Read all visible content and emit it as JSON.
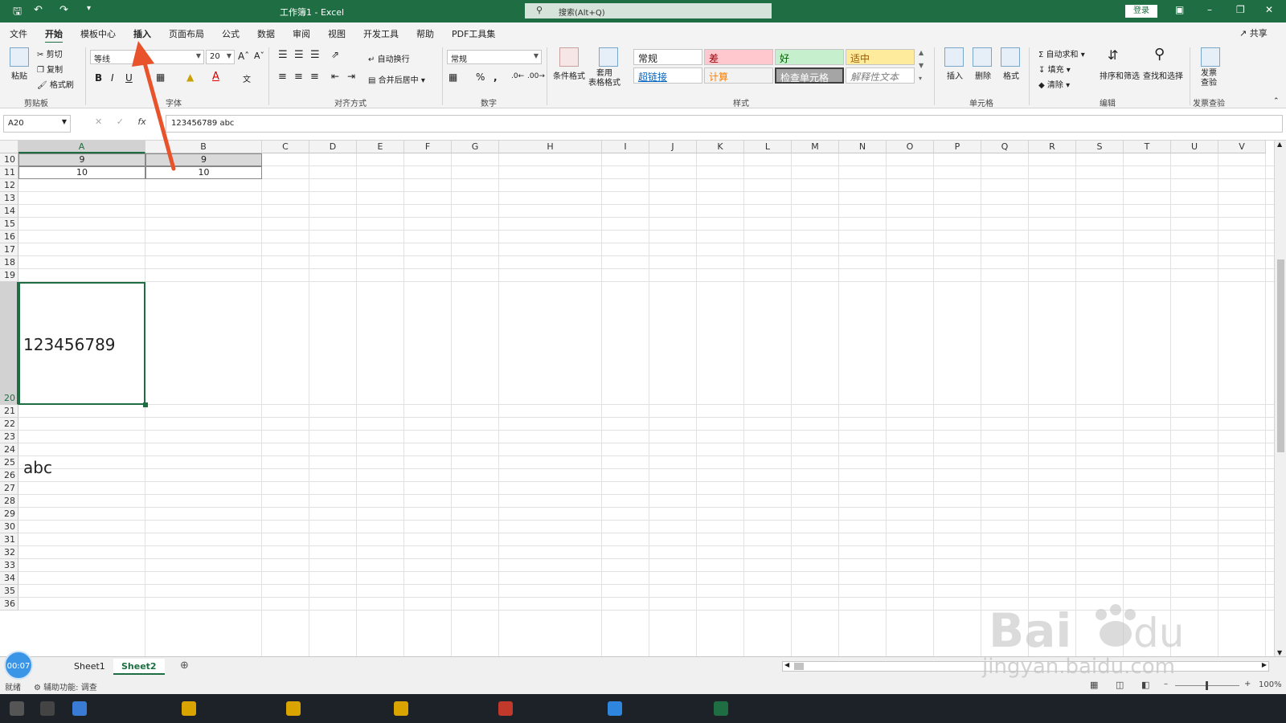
{
  "titlebar": {
    "title": "工作簿1  -  Excel",
    "search_placeholder": "搜索(Alt+Q)",
    "login": "登录"
  },
  "menu": {
    "tabs": [
      "文件",
      "开始",
      "模板中心",
      "插入",
      "页面布局",
      "公式",
      "数据",
      "审阅",
      "视图",
      "开发工具",
      "帮助",
      "PDF工具集"
    ],
    "active": "开始",
    "share": "共享"
  },
  "ribbon": {
    "clipboard": {
      "paste": "粘贴",
      "cut": "剪切",
      "copy": "复制",
      "format_painter": "格式刷",
      "label": "剪贴板"
    },
    "font": {
      "name": "等线",
      "size": "20",
      "label": "字体"
    },
    "alignment": {
      "wrap": "自动换行",
      "merge": "合并后居中",
      "label": "对齐方式"
    },
    "number": {
      "format": "常规",
      "label": "数字"
    },
    "styles": {
      "cond_format": "条件格式",
      "table_format": "套用\n表格格式",
      "items": [
        {
          "label": "常规",
          "bg": "#ffffff",
          "color": "#222222"
        },
        {
          "label": "差",
          "bg": "#ffc7ce",
          "color": "#9c0006"
        },
        {
          "label": "好",
          "bg": "#c6efce",
          "color": "#006100"
        },
        {
          "label": "适中",
          "bg": "#ffeb9c",
          "color": "#9c5700"
        },
        {
          "label": "超链接",
          "bg": "#ffffff",
          "color": "#0563c1"
        },
        {
          "label": "计算",
          "bg": "#f2f2f2",
          "color": "#fa7d00"
        },
        {
          "label": "检查单元格",
          "bg": "#a5a5a5",
          "color": "#ffffff"
        },
        {
          "label": "解释性文本",
          "bg": "#ffffff",
          "color": "#7f7f7f"
        }
      ],
      "label": "样式"
    },
    "cells": {
      "insert": "插入",
      "delete": "删除",
      "format": "格式",
      "label": "单元格"
    },
    "editing": {
      "autosum": "自动求和",
      "fill": "填充",
      "clear": "清除",
      "sort": "排序和筛选",
      "find": "查找和选择",
      "label": "编辑"
    },
    "invoice": {
      "check": "发票\n查验",
      "label": "发票查验"
    }
  },
  "formula_bar": {
    "namebox": "A20",
    "fx": "fx",
    "content": "123456789 abc"
  },
  "grid": {
    "columns": [
      "A",
      "B",
      "C",
      "D",
      "E",
      "F",
      "G",
      "H",
      "I",
      "J",
      "K",
      "L",
      "M",
      "N",
      "O",
      "P",
      "Q",
      "R",
      "S",
      "T",
      "U",
      "V"
    ],
    "rows": [
      "10",
      "11",
      "12",
      "13",
      "14",
      "15",
      "16",
      "17",
      "18",
      "19",
      "20",
      "21",
      "22",
      "23",
      "24",
      "25",
      "26",
      "27",
      "28",
      "29",
      "30",
      "31",
      "32",
      "33",
      "34",
      "35",
      "36"
    ],
    "cells": {
      "A10": "9",
      "B10": "9",
      "A11": "10",
      "B11": "10",
      "A20": "123456789 abc"
    }
  },
  "sheets": {
    "tabs": [
      "Sheet1",
      "Sheet2"
    ],
    "active": "Sheet2"
  },
  "status": {
    "ready": "就绪",
    "accessibility": "辅助功能: 调查",
    "zoom": "100%"
  },
  "overlay": {
    "timer": "00:07",
    "watermark_url": "jingyan.baidu.com"
  }
}
